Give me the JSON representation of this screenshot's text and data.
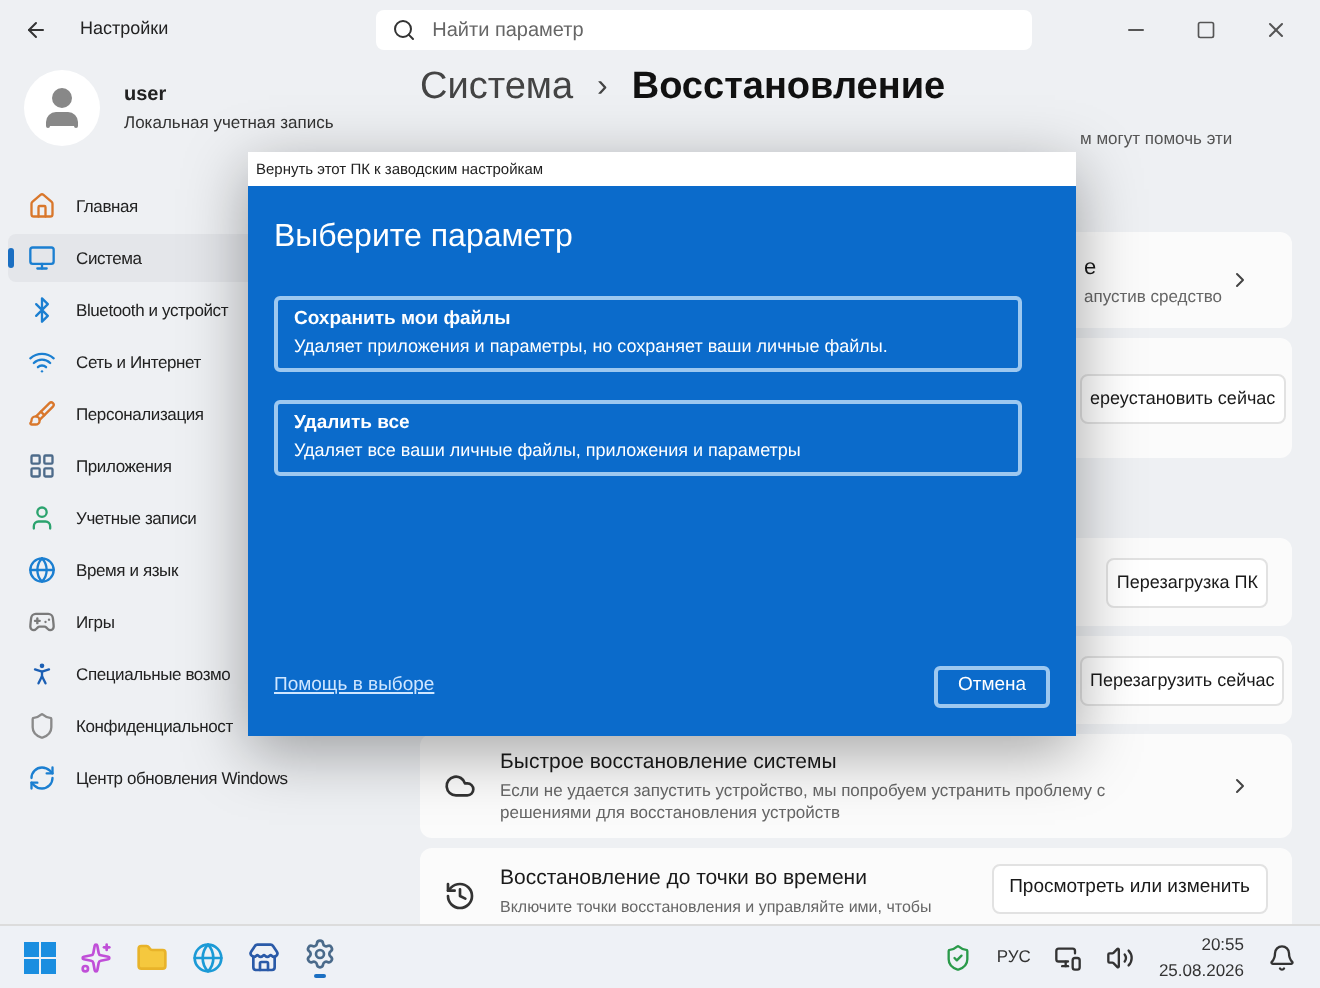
{
  "window": {
    "title": "Настройки",
    "search": {
      "placeholder": "Найти параметр"
    }
  },
  "profile": {
    "name": "user",
    "account": "Локальная учетная запись"
  },
  "sidebar": {
    "items": [
      {
        "label": "Главная",
        "selected": false
      },
      {
        "label": "Система",
        "selected": true
      },
      {
        "label": "Bluetooth и устройст",
        "selected": false
      },
      {
        "label": "Сеть и Интернет",
        "selected": false
      },
      {
        "label": "Персонализация",
        "selected": false
      },
      {
        "label": "Приложения",
        "selected": false
      },
      {
        "label": "Учетные записи",
        "selected": false
      },
      {
        "label": "Время и язык",
        "selected": false
      },
      {
        "label": "Игры",
        "selected": false
      },
      {
        "label": "Специальные возмо",
        "selected": false
      },
      {
        "label": "Конфиденциальност",
        "selected": false
      },
      {
        "label": "Центр обновления Windows",
        "selected": false
      }
    ]
  },
  "breadcrumb": {
    "parent": "Система",
    "separator": "›",
    "current": "Восстановление"
  },
  "intro": "м могут помочь эти",
  "cards": [
    {
      "kind": "covered_link",
      "title": "е",
      "description": "апустив средство"
    },
    {
      "kind": "covered_button",
      "button": "ереустановить сейчас"
    },
    {
      "kind": "covered_button",
      "button": "Перезагрузка ПК"
    },
    {
      "kind": "covered_button",
      "button": "Перезагрузить сейчас"
    },
    {
      "kind": "link",
      "title": "Быстрое восстановление системы",
      "description": "Если не удается запустить устройство, мы попробуем устранить проблему с решениями для восстановления устройств"
    },
    {
      "kind": "button",
      "title": "Восстановление до точки во времени",
      "description": "Включите точки восстановления и управляйте ими, чтобы",
      "button": "Просмотреть или изменить"
    }
  ],
  "dialog": {
    "title": "Вернуть этот ПК к заводским настройкам",
    "heading": "Выберите параметр",
    "options": [
      {
        "title": "Сохранить мои файлы",
        "description": "Удаляет приложения и параметры, но сохраняет ваши личные файлы."
      },
      {
        "title": "Удалить все",
        "description": "Удаляет все ваши личные файлы, приложения и параметры"
      }
    ],
    "help_link": "Помощь в выборе",
    "cancel": "Отмена"
  },
  "taskbar": {
    "language": "РУС",
    "time": "20:55",
    "date": "25.08.2026"
  }
}
